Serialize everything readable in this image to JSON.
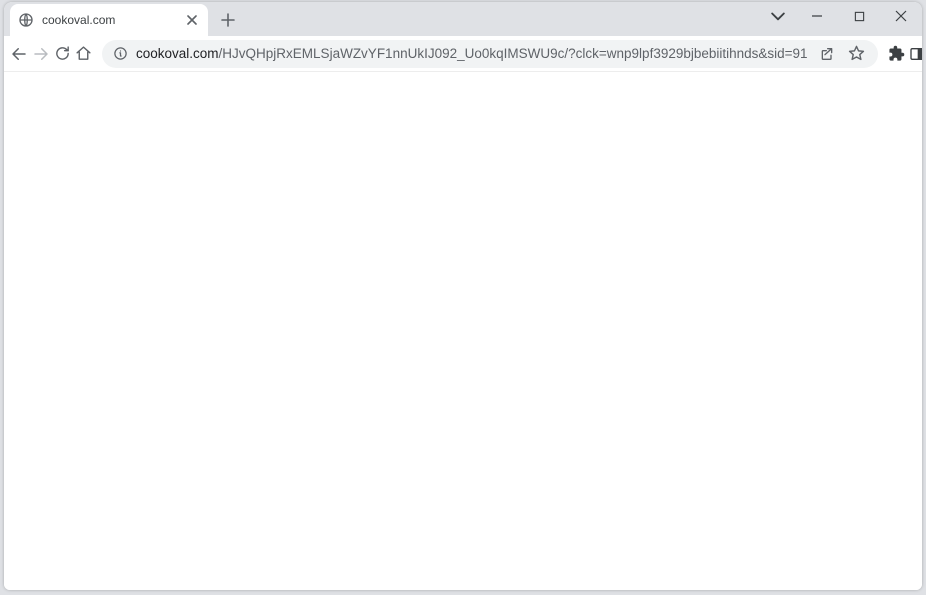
{
  "tab": {
    "title": "cookoval.com"
  },
  "url": {
    "domain": "cookoval.com",
    "path": "/HJvQHpjRxEMLSjaWZvYF1nnUkIJ092_Uo0kqIMSWU9c/?clck=wnp9lpf3929bjbebiitihnds&sid=91"
  }
}
